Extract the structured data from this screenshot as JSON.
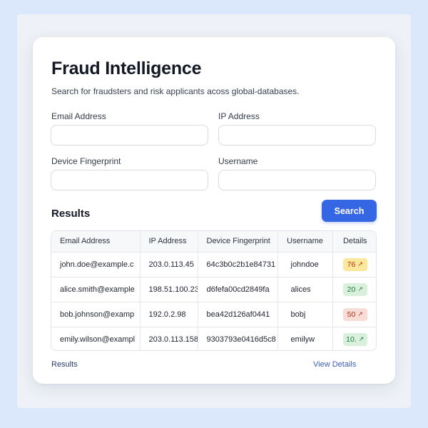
{
  "header": {
    "title": "Fraud Intelligence",
    "subtitle": "Search for fraudsters and risk applicants acoss global-databases."
  },
  "form": {
    "email": {
      "label": "Email Address",
      "value": "",
      "placeholder": ""
    },
    "ip": {
      "label": "IP Address",
      "value": "",
      "placeholder": ""
    },
    "fingerprint": {
      "label": "Device Fingerprint",
      "value": "",
      "placeholder": ""
    },
    "username": {
      "label": "Username",
      "value": "",
      "placeholder": ""
    },
    "search_label": "Search"
  },
  "results": {
    "title": "Results",
    "columns": [
      "Email Address",
      "IP Address",
      "Device Fingerprint",
      "Username",
      "Details"
    ],
    "rows": [
      {
        "email": "john.doe@example.c",
        "ip": "203.0.113.45",
        "fingerprint": "64c3b0c2b1e84731",
        "username": "johndoe",
        "score": "76",
        "score_level": "medium"
      },
      {
        "email": "alice.smith@example",
        "ip": "198.51.100.23",
        "fingerprint": "d6fefa00cd2849fa",
        "username": "alices",
        "score": "20",
        "score_level": "low"
      },
      {
        "email": "bob.johnson@examp",
        "ip": "192.0.2.98",
        "fingerprint": "bea42d126af0441",
        "username": "bobj",
        "score": "50",
        "score_level": "high"
      },
      {
        "email": "emily.wilson@exampl",
        "ip": "203.0.113.158",
        "fingerprint": "9303793e0416d5c8",
        "username": "emilyw",
        "score": "10.",
        "score_level": "low"
      }
    ]
  },
  "footer": {
    "left_label": "Results",
    "right_label": "View Details"
  },
  "colors": {
    "accent": "#3566e4",
    "badge_medium_bg": "#fbe89a",
    "badge_medium_fg": "#b5301b",
    "badge_low_bg": "#d9f0dd",
    "badge_low_fg": "#237a3b",
    "badge_high_bg": "#f8dcd6",
    "badge_high_fg": "#b5301b"
  },
  "icons": {
    "badge_arrow": "arrow-up-right-icon"
  }
}
